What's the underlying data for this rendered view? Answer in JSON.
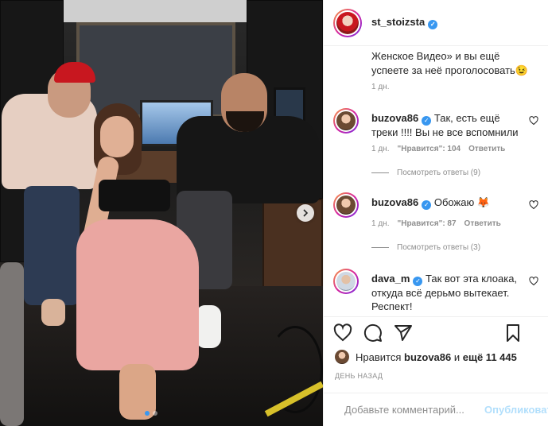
{
  "post": {
    "image_dots": {
      "count": 2,
      "active": 1
    },
    "icons": {
      "next_arrow": "chevron-right-icon"
    }
  },
  "header": {
    "username": "st_stoizsta",
    "verified": true
  },
  "caption": {
    "text_tail": "Женское Видео» и вы ещё успеете за неё проголосовать😉",
    "time": "1 дн."
  },
  "comments": [
    {
      "username": "buzova86",
      "verified": true,
      "text": "Так, есть ещё треки !!!! Вы не все вспомнили",
      "time": "1 дн.",
      "likes": "\"Нравится\": 104",
      "reply": "Ответить",
      "view_replies": "Посмотреть ответы (9)"
    },
    {
      "username": "buzova86",
      "verified": true,
      "text": "Обожаю 🦊",
      "time": "1 дн.",
      "likes": "\"Нравится\": 87",
      "reply": "Ответить",
      "view_replies": "Посмотреть ответы (3)"
    },
    {
      "username": "dava_m",
      "verified": true,
      "text": "Так вот эта клоака, откуда всё дерьмо вытекает. Респект!"
    }
  ],
  "likes_line": {
    "prefix": "Нравится",
    "user": "buzova86",
    "joiner": "и",
    "others": "ещё 11 445"
  },
  "time_ago": "ДЕНЬ НАЗАД",
  "add_comment": {
    "placeholder": "Добавьте комментарий...",
    "publish_label": "Опубликовать"
  },
  "colors": {
    "accent": "#3897f0",
    "muted": "#8e8e8e",
    "text": "#262626"
  }
}
